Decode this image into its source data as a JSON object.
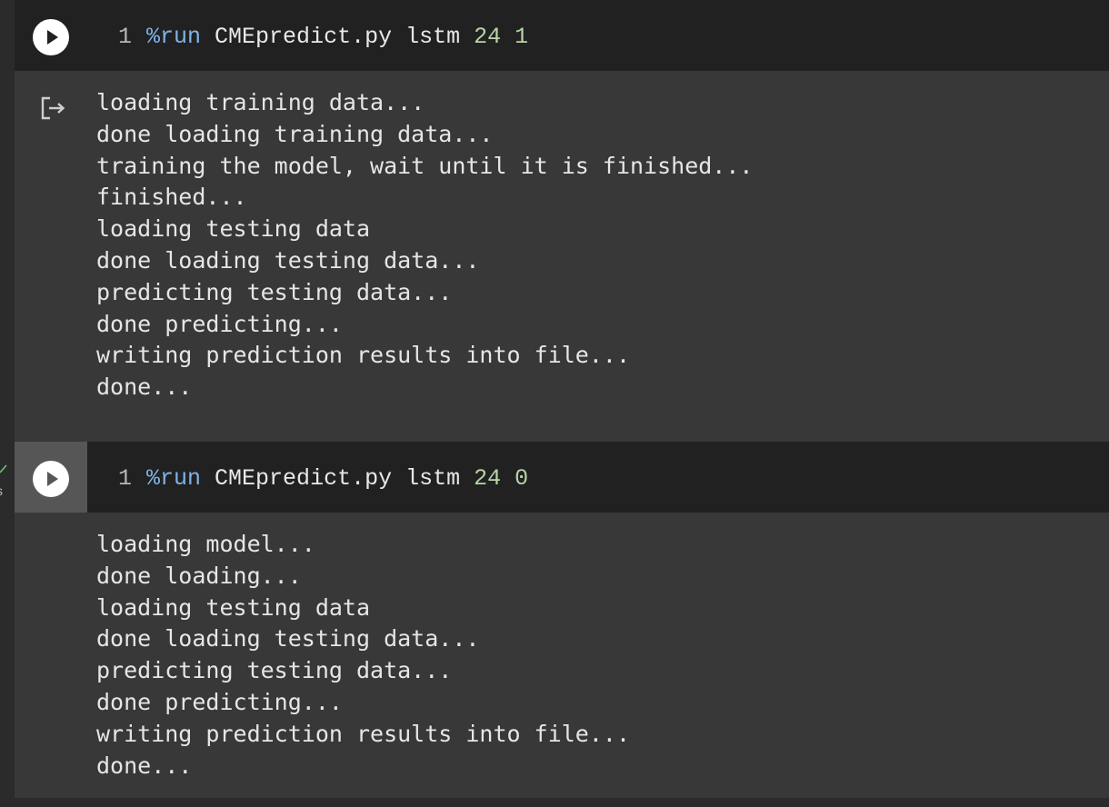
{
  "cells": [
    {
      "line_number": "1",
      "magic": "%run",
      "script": "CMEpredict.py",
      "model": "lstm",
      "arg1": "24",
      "arg2": "1",
      "output": [
        "loading training data...",
        "done loading training data...",
        "training the model, wait until it is finished...",
        "finished...",
        "loading testing data",
        "done loading testing data...",
        "predicting testing data...",
        "done predicting...",
        "writing prediction results into file...",
        "done..."
      ]
    },
    {
      "line_number": "1",
      "magic": "%run",
      "script": "CMEpredict.py",
      "model": "lstm",
      "arg1": "24",
      "arg2": "0",
      "output": [
        "loading model...",
        "done loading...",
        "loading testing data",
        "done loading testing data...",
        "predicting testing data...",
        "done predicting...",
        "writing prediction results into file...",
        "done..."
      ]
    }
  ],
  "status": {
    "time_fragment": "s",
    "check_color": "#6cc36c"
  },
  "colors": {
    "background": "#383838",
    "code_bg": "#212121",
    "magic": "#7fb3e8",
    "number": "#b7d4a8"
  },
  "icons": {
    "run": "play-circle-icon",
    "output": "output-redirect-icon",
    "status": "check-icon"
  }
}
